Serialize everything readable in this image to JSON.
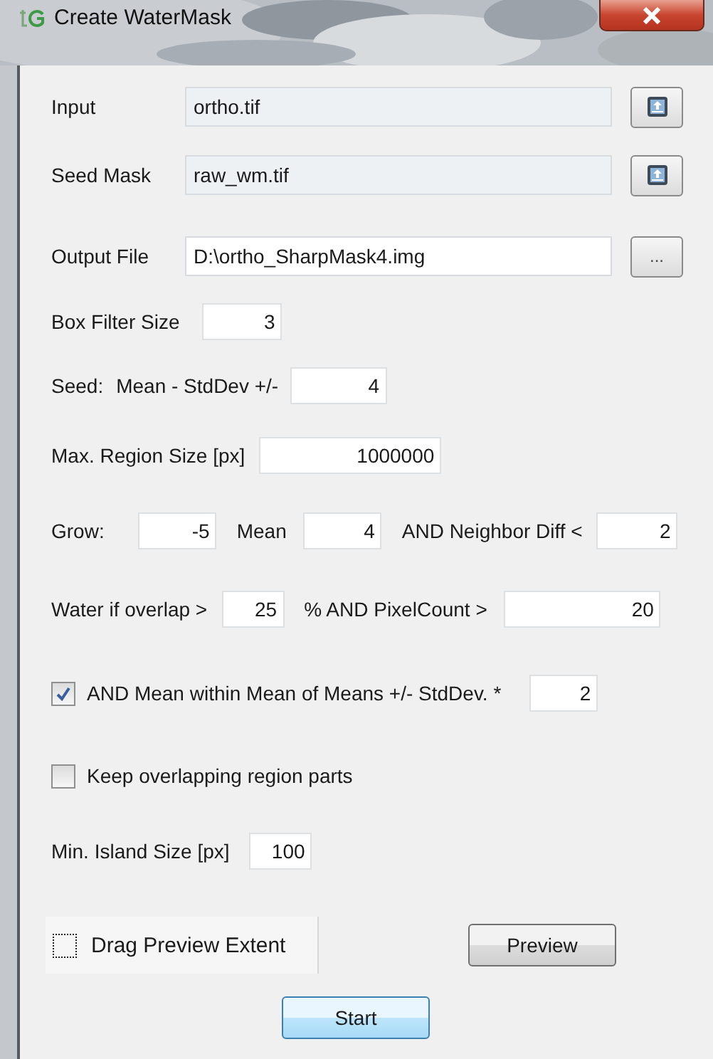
{
  "window": {
    "title": "Create WaterMask"
  },
  "file_rows": [
    {
      "label": "Input",
      "value": "ortho.tif",
      "readonly": true,
      "button": {
        "kind": "open"
      }
    },
    {
      "label": "Seed Mask",
      "value": "raw_wm.tif",
      "readonly": true,
      "button": {
        "kind": "open"
      }
    },
    {
      "label": "Output File",
      "value": "D:\\ortho_SharpMask4.img",
      "readonly": false,
      "button": {
        "kind": "browse",
        "label": "..."
      }
    }
  ],
  "param_rows": [
    {
      "parts": [
        {
          "kind": "label",
          "text": "Box Filter Size"
        },
        {
          "kind": "field",
          "value": "3"
        }
      ]
    },
    {
      "parts": [
        {
          "kind": "label",
          "text": "Seed:"
        },
        {
          "kind": "label",
          "text": "Mean - StdDev +/-"
        },
        {
          "kind": "field",
          "value": "4"
        }
      ]
    },
    {
      "parts": [
        {
          "kind": "label",
          "text": "Max. Region Size [px]"
        },
        {
          "kind": "field",
          "value": "1000000"
        }
      ]
    },
    {
      "parts": [
        {
          "kind": "label",
          "text": "Grow:"
        },
        {
          "kind": "field",
          "value": "-5"
        },
        {
          "kind": "label",
          "text": "Mean"
        },
        {
          "kind": "field",
          "value": "4"
        },
        {
          "kind": "label",
          "text": "AND Neighbor Diff <"
        },
        {
          "kind": "field",
          "value": "2"
        }
      ]
    },
    {
      "parts": [
        {
          "kind": "label",
          "text": "Water if overlap >"
        },
        {
          "kind": "field",
          "value": "25"
        },
        {
          "kind": "label",
          "text": "% AND PixelCount >"
        },
        {
          "kind": "field",
          "value": "20"
        }
      ]
    },
    {
      "parts": [
        {
          "kind": "checkbox",
          "text": "AND Mean within Mean of Means +/- StdDev. *",
          "checked": true
        },
        {
          "kind": "field",
          "value": "2"
        }
      ]
    },
    {
      "parts": [
        {
          "kind": "checkbox",
          "text": "Keep overlapping region parts",
          "checked": false
        }
      ]
    },
    {
      "parts": [
        {
          "kind": "label",
          "text": "Min. Island Size [px]"
        },
        {
          "kind": "field",
          "value": "100"
        }
      ]
    }
  ],
  "drag_toggle": {
    "label": "Drag Preview Extent",
    "checked": false
  },
  "preview_button": "Preview",
  "start_button": "Start"
}
